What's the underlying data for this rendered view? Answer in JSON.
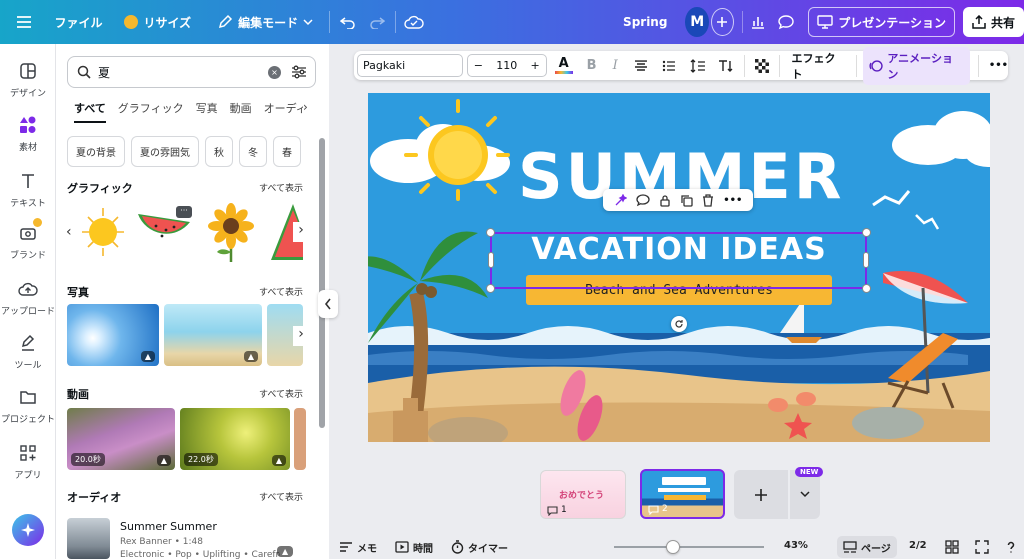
{
  "topbar": {
    "file": "ファイル",
    "resize": "リサイズ",
    "edit_mode": "編集モード",
    "project_name": "Spring",
    "avatar_initial": "M",
    "present": "プレゼンテーション",
    "share": "共有"
  },
  "rail": {
    "items": [
      {
        "label": "デザイン",
        "icon": "layout-icon"
      },
      {
        "label": "素材",
        "icon": "elements-icon"
      },
      {
        "label": "テキスト",
        "icon": "text-icon"
      },
      {
        "label": "ブランド",
        "icon": "brand-icon"
      },
      {
        "label": "アップロード",
        "icon": "upload-icon"
      },
      {
        "label": "ツール",
        "icon": "draw-icon"
      },
      {
        "label": "プロジェクト",
        "icon": "folder-icon"
      },
      {
        "label": "アプリ",
        "icon": "apps-icon"
      }
    ]
  },
  "panel": {
    "search_value": "夏",
    "tabs": [
      "すべて",
      "グラフィック",
      "写真",
      "動画",
      "オーディ"
    ],
    "chips": [
      "夏の背景",
      "夏の雰囲気",
      "秋",
      "冬",
      "春"
    ],
    "see_all": "すべて表示",
    "sections": {
      "graphics": "グラフィック",
      "photos": "写真",
      "videos": "動画",
      "audio": "オーディオ"
    },
    "videos": [
      {
        "duration": "20.0秒"
      },
      {
        "duration": "22.0秒"
      }
    ],
    "audio_item": {
      "title": "Summer Summer",
      "meta": "Rex Banner • 1:48",
      "tags": "Electronic • Pop • Uplifting • Carefre"
    }
  },
  "toolbar": {
    "font": "Pagkaki",
    "font_size": "110",
    "minus": "−",
    "plus": "+",
    "effects": "エフェクト",
    "animation": "アニメーション",
    "more": "•••"
  },
  "slide": {
    "title": "SUMMER",
    "subtitle": "VACATION IDEAS",
    "tagline": "Beach and Sea Adventures"
  },
  "pages": {
    "page1_num": "1",
    "page1_text": "おめでとう",
    "page2_num": "2",
    "new_badge": "NEW"
  },
  "bottombar": {
    "notes": "メモ",
    "time": "時間",
    "timer": "タイマー",
    "zoom": "43%",
    "zoom_fraction": 0.43,
    "pages_label": "ページ",
    "page_count": "2/2"
  },
  "colors": {
    "accent": "#7d2ae8",
    "sky": "#2d9bde",
    "sand": "#e8c48a",
    "tagline_bg": "#f7b733"
  }
}
